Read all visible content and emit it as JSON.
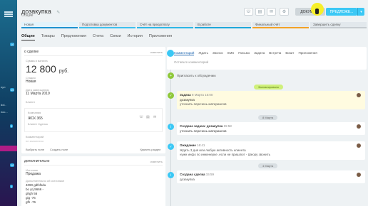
{
  "rail": {
    "texts": [
      "пул",
      "dol..",
      "пос..."
    ],
    "badges": [
      "10",
      "10",
      "3",
      "10",
      "1"
    ]
  },
  "header": {
    "title": "дозакупка",
    "subtitle": "Общие",
    "doc_button": "ДОКУМЕНТ",
    "main_button": "ПРЕДЛОЖЕ..."
  },
  "stages": [
    "Новая",
    "Подготовка документов",
    "Счёт на предоплату",
    "В работе",
    "Финальный счёт",
    "Завершить сделку"
  ],
  "tabs": [
    "Общие",
    "Товары",
    "Предложения",
    "Счета",
    "Связи",
    "История",
    "Приложения"
  ],
  "left_card": {
    "header": "о сделке",
    "edit": "изменить",
    "amount_label": "Сумма и валюта",
    "amount_value": "12 800",
    "amount_currency": "руб.",
    "stage_label": "Стадия",
    "stage_value": "Новая",
    "date_label": "Дата завершения",
    "date_value": "11 Марта 2019",
    "client_label": "Клиент",
    "client_company_label": "Компания",
    "client_company": "ЖСК 365",
    "client_contact": "Клиент Сделок",
    "comment_label": "Комментарий",
    "comment_value": "не заполнено",
    "select_field": "Выбрать поле",
    "create_field": "Создать поле",
    "delete_section": "Удалить раздел"
  },
  "left_card2": {
    "header": "дополнительно",
    "edit": "изменить",
    "source_label": "Источник",
    "source_value": "Продажа",
    "info_label": "Дополнительно об источнике",
    "info_lines": [
      "4090 gdfsfsdu",
      "bo yrj 5666 -",
      "ghgh 56",
      "gig -76",
      "gfh -76"
    ]
  },
  "feed": {
    "tabs": [
      "Комментарий",
      "Ждать",
      "Звонок",
      "SMS",
      "Письмо",
      "Задача",
      "Встреча",
      "Визит",
      "Приложения"
    ],
    "input_placeholder": "Оставьте комментарий",
    "invite": "Пригласить к обсуждению",
    "planned_pill": "Запланировано",
    "task_title": "Задача",
    "task_date": "8 Марта 15:00",
    "task_name": "дозакупка",
    "task_desc": "уточнить перечень материалов",
    "date_pill_1": "8 Марта",
    "created_task_title": "Создана задача: дозакупка",
    "created_task_time": "15:58",
    "created_task_desc": "уточнить перечень материалов",
    "wait_title": "Ожидание",
    "wait_time": "16:41",
    "wait_text_1": "Ждать 3 дня или любую активность клиента",
    "wait_text_2": "нужн инфо по инженерке .если не пришлют - Шеору звонить",
    "date_pill_2": "4 Марта",
    "created_deal_title": "Создана сделка",
    "created_deal_time": "15:59",
    "created_deal_name": "дозакупка"
  },
  "colors": {
    "accent": "#3bc8f5",
    "link": "#2067b0",
    "planned": "#cff07a"
  }
}
